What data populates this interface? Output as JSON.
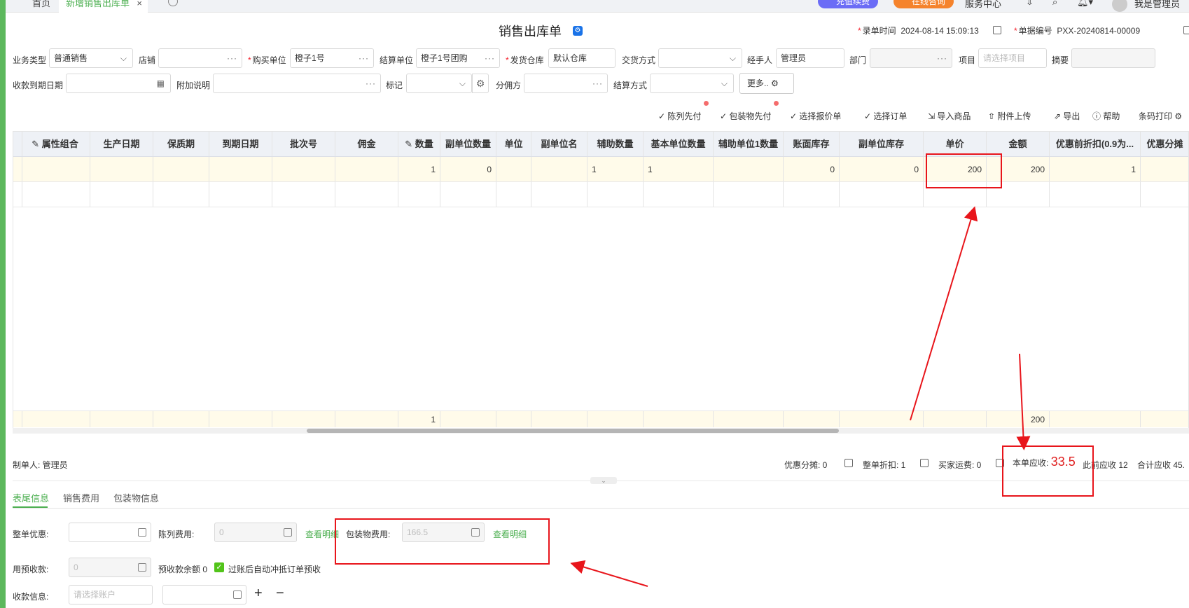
{
  "tabs": {
    "home": "首页",
    "active": "新增销售出库单",
    "close": "×"
  },
  "topbar": {
    "recharge": "充值续费",
    "consult": "在线咨询",
    "service": "服务中心",
    "user": "我是管理员"
  },
  "title": "销售出库单",
  "meta": {
    "entry_time_label": "录单时间",
    "entry_time_value": "2024-08-14 15:09:13",
    "doc_no_label": "单据编号",
    "doc_no_value": "PXX-20240814-00009"
  },
  "form": {
    "biz_type": {
      "label": "业务类型",
      "value": "普通销售"
    },
    "shop": {
      "label": "店铺",
      "value": ""
    },
    "buyer": {
      "label": "购买单位",
      "value": "橙子1号"
    },
    "settle_unit": {
      "label": "结算单位",
      "value": "橙子1号团购"
    },
    "warehouse": {
      "label": "发货仓库",
      "value": "默认仓库"
    },
    "trade_mode": {
      "label": "交货方式",
      "value": ""
    },
    "handler": {
      "label": "经手人",
      "value": "管理员"
    },
    "dept": {
      "label": "部门",
      "value": ""
    },
    "project": {
      "label": "项目",
      "placeholder": "请选择项目"
    },
    "summary": {
      "label": "摘要",
      "value": ""
    },
    "due_date": {
      "label": "收款到期日期",
      "value": ""
    },
    "note": {
      "label": "附加说明",
      "value": ""
    },
    "mark": {
      "label": "标记",
      "value": ""
    },
    "commission": {
      "label": "分佣方",
      "value": ""
    },
    "settle_mode": {
      "label": "结算方式",
      "value": ""
    },
    "more": "更多.."
  },
  "toolbar": [
    "陈列先付",
    "包装物先付",
    "选择报价单",
    "选择订单",
    "导入商品",
    "附件上传",
    "导出",
    "帮助",
    "条码打印"
  ],
  "grid": {
    "headers": [
      "属性组合",
      "生产日期",
      "保质期",
      "到期日期",
      "批次号",
      "佣金",
      "数量",
      "副单位数量",
      "单位",
      "副单位名",
      "辅助数量",
      "基本单位数量",
      "辅助单位1数量",
      "账面库存",
      "副单位库存",
      "单价",
      "金额",
      "优惠前折扣(0.9为...",
      "优惠分摊"
    ],
    "row1": {
      "qty": "1",
      "sub_qty": "0",
      "aux_qty": "1",
      "base_qty": "1",
      "book_stock": "0",
      "sub_stock": "0",
      "price": "200",
      "amount": "200",
      "discount": "1"
    },
    "sum": {
      "qty": "1",
      "amount": "200"
    }
  },
  "footer": {
    "maker": "制单人: 管理员",
    "discount_share": "优惠分摊: 0",
    "whole_discount": "整单折扣: 1",
    "buyer_freight": "买家运费: 0",
    "receivable_label": "本单应收:",
    "receivable_value": "33.5",
    "prior_receivable": "此前应收 12",
    "total_receivable": "合计应收 45."
  },
  "subtabs": [
    "表尾信息",
    "销售费用",
    "包装物信息"
  ],
  "tail": {
    "whole_discount_label": "整单优惠:",
    "display_fee_label": "陈列费用:",
    "display_fee_value": "0",
    "view_detail": "查看明细",
    "package_fee_label": "包装物费用:",
    "package_fee_value": "166.5",
    "prepay_label": "用预收款:",
    "prepay_value": "0",
    "prepay_balance": "预收款余额 0",
    "auto_offset": "过账后自动冲抵订单预收",
    "pay_info_label": "收款信息:",
    "account_placeholder": "请选择账户"
  }
}
